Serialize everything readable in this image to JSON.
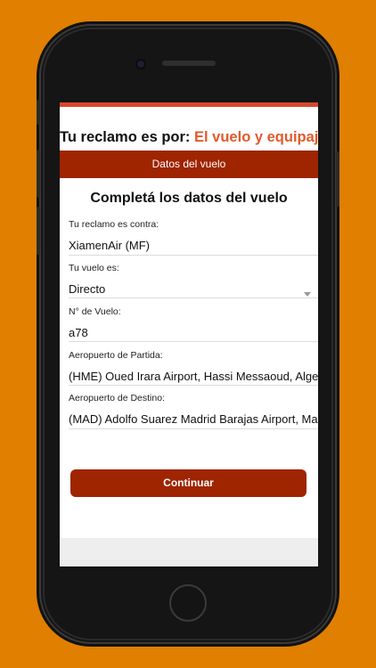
{
  "header": {
    "prefix": "Tu reclamo es por:",
    "highlight": "El vuelo y equipaje"
  },
  "section": {
    "title": "Datos del vuelo"
  },
  "form": {
    "title": "Completá los datos del vuelo",
    "fields": [
      {
        "label": "Tu reclamo es contra:",
        "value": "XiamenAir (MF)"
      },
      {
        "label": "Tu vuelo es:",
        "value": "Directo"
      },
      {
        "label": "N° de Vuelo:",
        "value": "a78"
      },
      {
        "label": "Aeropuerto de Partida:",
        "value": "(HME) Oued Irara Airport, Hassi Messaoud, Algeria"
      },
      {
        "label": "Aeropuerto de Destino:",
        "value": "(MAD) Adolfo Suarez Madrid Barajas Airport, Madrid, Spain"
      }
    ]
  },
  "actions": {
    "continue_label": "Continuar"
  },
  "colors": {
    "background": "#E07F00",
    "accent": "#9F2400",
    "highlight": "#E25A2C"
  }
}
